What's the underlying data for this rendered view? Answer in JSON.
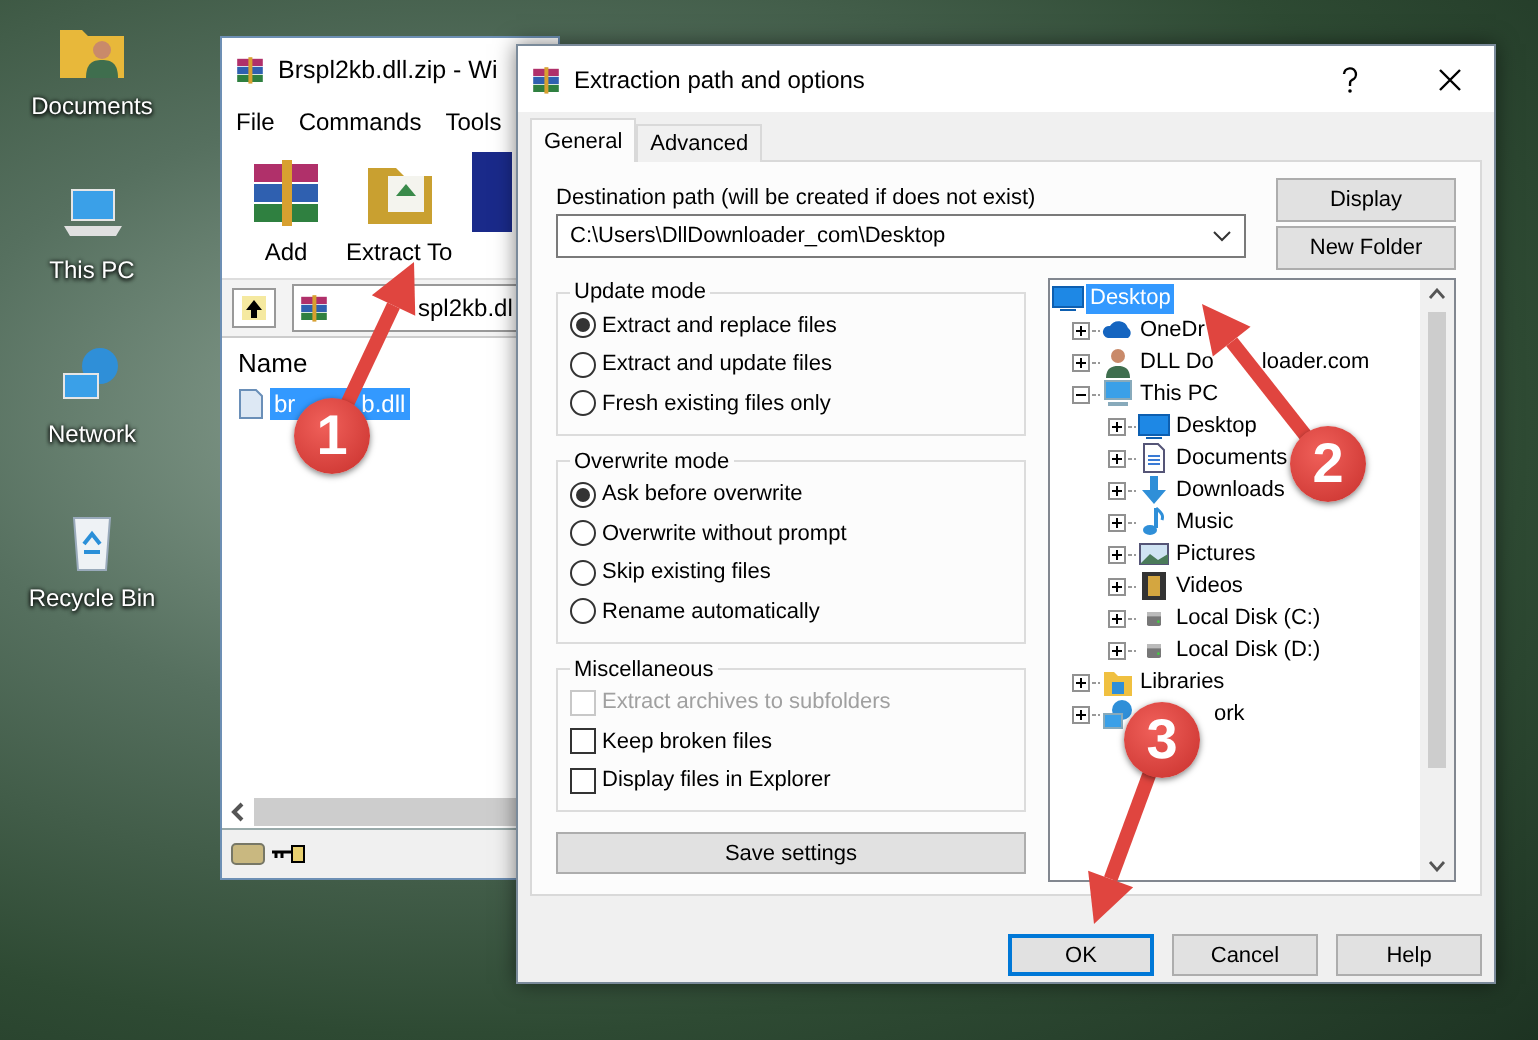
{
  "desktop_icons": [
    {
      "label": "Documents",
      "kind": "documents"
    },
    {
      "label": "This PC",
      "kind": "pc"
    },
    {
      "label": "Network",
      "kind": "network"
    },
    {
      "label": "Recycle Bin",
      "kind": "recycle"
    }
  ],
  "archive_window": {
    "title": "Brspl2kb.dll.zip - Wi",
    "menu": [
      "File",
      "Commands",
      "Tools"
    ],
    "toolbar": [
      {
        "label": "Add",
        "kind": "add"
      },
      {
        "label": "Extract To",
        "kind": "extract"
      },
      {
        "kind": "view"
      }
    ],
    "address": {
      "text": "spl2kb.dl",
      "covered": true
    },
    "columns": [
      "Name"
    ],
    "files": [
      {
        "label_parts": [
          "br",
          "b.dll"
        ],
        "selected": true
      }
    ]
  },
  "dialog": {
    "title": "Extraction path and options",
    "tabs": [
      {
        "label": "General",
        "selected": true
      },
      {
        "label": "Advanced",
        "selected": false
      }
    ],
    "destination": {
      "label": "Destination path (will be created if does not exist)",
      "value": "C:\\Users\\DllDownloader_com\\Desktop"
    },
    "side_buttons": [
      "Display",
      "New Folder"
    ],
    "groups": [
      {
        "title": "Update mode",
        "options": [
          {
            "kind": "radio",
            "label": "Extract and replace files",
            "checked": true,
            "disabled": false
          },
          {
            "kind": "radio",
            "label": "Extract and update files",
            "checked": false,
            "disabled": false
          },
          {
            "kind": "radio",
            "label": "Fresh existing files only",
            "checked": false,
            "disabled": false
          }
        ]
      },
      {
        "title": "Overwrite mode",
        "options": [
          {
            "kind": "radio",
            "label": "Ask before overwrite",
            "checked": true,
            "disabled": false
          },
          {
            "kind": "radio",
            "label": "Overwrite without prompt",
            "checked": false,
            "disabled": false
          },
          {
            "kind": "radio",
            "label": "Skip existing files",
            "checked": false,
            "disabled": false
          },
          {
            "kind": "radio",
            "label": "Rename automatically",
            "checked": false,
            "disabled": false
          }
        ]
      },
      {
        "title": "Miscellaneous",
        "options": [
          {
            "kind": "checkbox",
            "label": "Extract archives to subfolders",
            "checked": false,
            "disabled": true
          },
          {
            "kind": "checkbox",
            "label": "Keep broken files",
            "checked": false,
            "disabled": false
          },
          {
            "kind": "checkbox",
            "label": "Display files in Explorer",
            "checked": false,
            "disabled": false
          }
        ]
      }
    ],
    "save_button": "Save settings",
    "tree": [
      {
        "label": "Desktop",
        "kind": "desktop",
        "selected": true,
        "children": [
          {
            "label": "OneDr",
            "kind": "cloud",
            "selected": false,
            "expanded": false
          },
          {
            "label_parts": [
              "DLL Do",
              "loader.com"
            ],
            "kind": "user",
            "selected": false,
            "expanded": false
          },
          {
            "label": "This PC",
            "kind": "pc",
            "selected": false,
            "expanded": true,
            "children": [
              {
                "label": "Desktop",
                "kind": "desktop",
                "selected": false,
                "expanded": false
              },
              {
                "label": "Documents",
                "kind": "documents",
                "selected": false,
                "expanded": false
              },
              {
                "label": "Downloads",
                "kind": "downloads",
                "selected": false,
                "expanded": false
              },
              {
                "label": "Music",
                "kind": "music",
                "selected": false,
                "expanded": false
              },
              {
                "label": "Pictures",
                "kind": "pictures",
                "selected": false,
                "expanded": false
              },
              {
                "label": "Videos",
                "kind": "videos",
                "selected": false,
                "expanded": false
              },
              {
                "label": "Local Disk (C:)",
                "kind": "disk",
                "selected": false,
                "expanded": false
              },
              {
                "label": "Local Disk (D:)",
                "kind": "disk",
                "selected": false,
                "expanded": false
              }
            ]
          },
          {
            "label": "Libraries",
            "kind": "libraries",
            "selected": false,
            "expanded": false
          },
          {
            "label": "ork",
            "kind": "network",
            "selected": false,
            "expanded": false,
            "covered": true
          }
        ]
      }
    ],
    "buttons": [
      {
        "label": "OK",
        "default": true
      },
      {
        "label": "Cancel",
        "default": false
      },
      {
        "label": "Help",
        "default": false
      }
    ]
  },
  "annotations": [
    {
      "number": "1"
    },
    {
      "number": "2"
    },
    {
      "number": "3"
    }
  ]
}
